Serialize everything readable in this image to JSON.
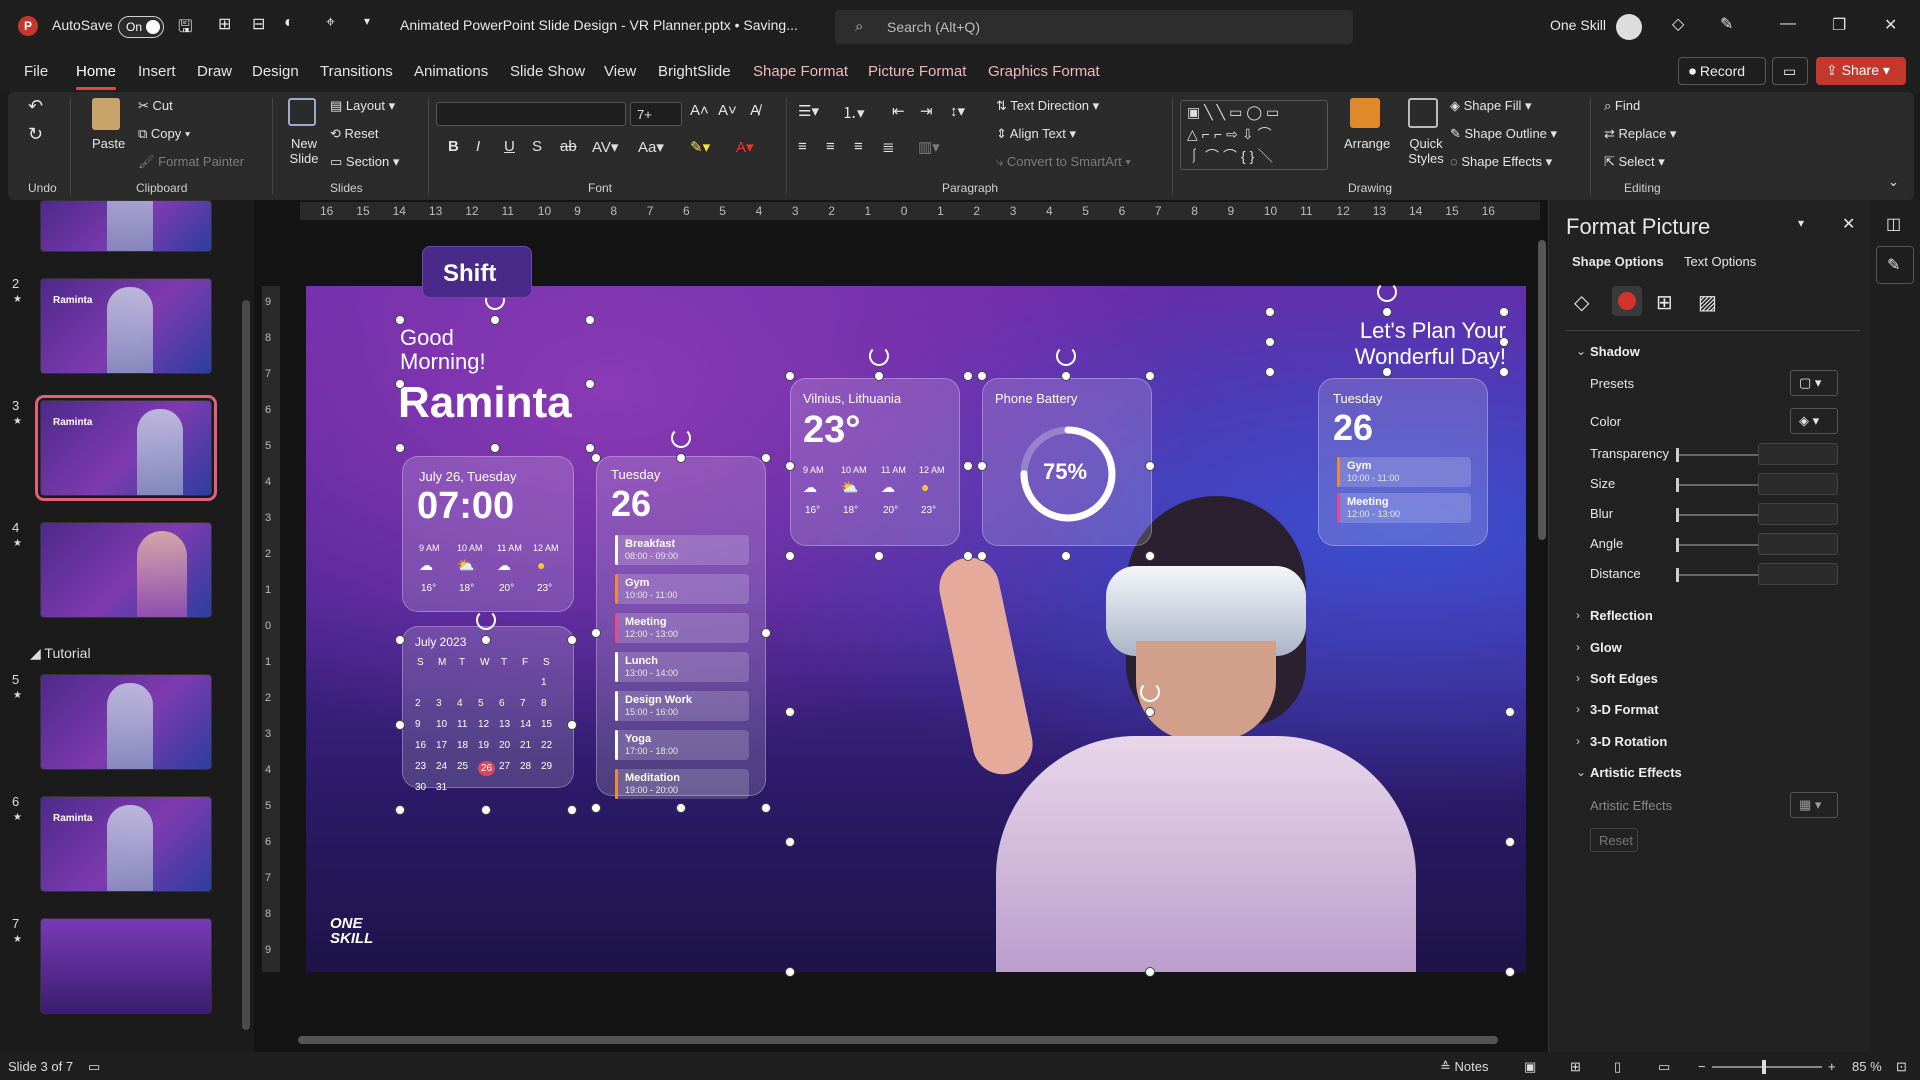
{
  "titlebar": {
    "autosave_label": "AutoSave",
    "autosave_state": "On",
    "doc_title": "Animated PowerPoint Slide Design - VR Planner.pptx • Saving...",
    "search_placeholder": "Search (Alt+Q)",
    "user_name": "One Skill"
  },
  "menu": {
    "tabs": [
      "File",
      "Home",
      "Insert",
      "Draw",
      "Design",
      "Transitions",
      "Animations",
      "Slide Show",
      "View",
      "BrightSlide",
      "Shape Format",
      "Picture Format",
      "Graphics Format"
    ],
    "active": "Home",
    "record_label": "Record",
    "share_label": "Share"
  },
  "ribbon": {
    "undo_group": "Undo",
    "clipboard": {
      "paste": "Paste",
      "cut": "Cut",
      "copy": "Copy",
      "format_painter": "Format Painter",
      "group": "Clipboard"
    },
    "slides": {
      "new_slide": "New Slide",
      "layout": "Layout",
      "reset": "Reset",
      "section": "Section",
      "group": "Slides"
    },
    "font": {
      "size": "7+",
      "group": "Font"
    },
    "paragraph": {
      "text_direction": "Text Direction",
      "align_text": "Align Text",
      "convert_smartart": "Convert to SmartArt",
      "group": "Paragraph"
    },
    "drawing": {
      "arrange": "Arrange",
      "quick_styles": "Quick Styles",
      "shape_fill": "Shape Fill",
      "shape_outline": "Shape Outline",
      "shape_effects": "Shape Effects",
      "group": "Drawing"
    },
    "editing": {
      "find": "Find",
      "replace": "Replace",
      "select": "Select",
      "group": "Editing"
    }
  },
  "slides_panel": {
    "section_name": "Tutorial",
    "thumbs": [
      {
        "num": "2",
        "title": "Raminta"
      },
      {
        "num": "3",
        "title": "Raminta"
      },
      {
        "num": "4",
        "title": ""
      },
      {
        "num": "5",
        "title": ""
      },
      {
        "num": "6",
        "title": "Raminta"
      },
      {
        "num": "7",
        "title": ""
      }
    ]
  },
  "canvas": {
    "shift_key": "Shift",
    "ruler_h": [
      "16",
      "15",
      "14",
      "13",
      "12",
      "11",
      "10",
      "9",
      "8",
      "7",
      "6",
      "5",
      "4",
      "3",
      "2",
      "1",
      "0",
      "1",
      "2",
      "3",
      "4",
      "5",
      "6",
      "7",
      "8",
      "9",
      "10",
      "11",
      "12",
      "13",
      "14",
      "15",
      "16"
    ],
    "ruler_v": [
      "9",
      "8",
      "7",
      "6",
      "5",
      "4",
      "3",
      "2",
      "1",
      "0",
      "1",
      "2",
      "3",
      "4",
      "5",
      "6",
      "7",
      "8",
      "9"
    ]
  },
  "slide": {
    "greeting": "Good Morning!",
    "name": "Raminta",
    "tagline": "Let's Plan Your Wonderful Day!",
    "clock_card": {
      "date": "July 26, Tuesday",
      "time": "07:00",
      "hours": [
        "9 AM",
        "10 AM",
        "11 AM",
        "12 AM"
      ],
      "temps": [
        "16°",
        "18°",
        "20°",
        "23°"
      ]
    },
    "calendar": {
      "title": "July 2023",
      "weekdays": [
        "S",
        "M",
        "T",
        "W",
        "T",
        "F",
        "S"
      ],
      "rows": [
        [
          "",
          "",
          "",
          "",
          "",
          "",
          "1"
        ],
        [
          "2",
          "3",
          "4",
          "5",
          "6",
          "7",
          "8"
        ],
        [
          "9",
          "10",
          "11",
          "12",
          "13",
          "14",
          "15"
        ],
        [
          "16",
          "17",
          "18",
          "19",
          "20",
          "21",
          "22"
        ],
        [
          "23",
          "24",
          "25",
          "26",
          "27",
          "28",
          "29"
        ],
        [
          "30",
          "31",
          "",
          "",
          "",
          "",
          ""
        ]
      ],
      "highlight": "26"
    },
    "schedule": {
      "day": "Tuesday",
      "date": "26",
      "events": [
        {
          "name": "Breakfast",
          "time": "08:00 - 09:00"
        },
        {
          "name": "Gym",
          "time": "10:00 - 11:00"
        },
        {
          "name": "Meeting",
          "time": "12:00 - 13:00"
        },
        {
          "name": "Lunch",
          "time": "13:00 - 14:00"
        },
        {
          "name": "Design Work",
          "time": "15:00 - 16:00"
        },
        {
          "name": "Yoga",
          "time": "17:00 - 18:00"
        },
        {
          "name": "Meditation",
          "time": "19:00 - 20:00"
        }
      ],
      "colors": [
        "#ffffff",
        "#f08a3a",
        "#e9478f",
        "#ffffff",
        "#ffffff",
        "#ffffff",
        "#f08a3a"
      ]
    },
    "weather": {
      "city": "Vilnius, Lithuania",
      "temp": "23°",
      "hours": [
        "9 AM",
        "10 AM",
        "11 AM",
        "12 AM"
      ],
      "temps": [
        "16°",
        "18°",
        "20°",
        "23°"
      ]
    },
    "battery": {
      "label": "Phone Battery",
      "percent_text": "75%",
      "level": 0.75
    },
    "mini_schedule": {
      "day": "Tuesday",
      "date": "26",
      "events": [
        {
          "name": "Gym",
          "time": "10:00 - 11:00"
        },
        {
          "name": "Meeting",
          "time": "12:00 - 13:00"
        }
      ]
    },
    "logo_text": "ONE SKILL"
  },
  "format_pane": {
    "title": "Format Picture",
    "tab_shape": "Shape Options",
    "tab_text": "Text Options",
    "shadow": "Shadow",
    "props": [
      "Presets",
      "Color",
      "Transparency",
      "Size",
      "Blur",
      "Angle",
      "Distance"
    ],
    "sections": [
      "Reflection",
      "Glow",
      "Soft Edges",
      "3-D Format",
      "3-D Rotation",
      "Artistic Effects"
    ],
    "artistic_effects_label": "Artistic Effects",
    "reset_label": "Reset"
  },
  "status": {
    "slide_info": "Slide 3 of 7",
    "notes": "Notes",
    "zoom": "85 %"
  },
  "colors": {
    "accent": "#c4372c",
    "selection": "#e4607a"
  }
}
